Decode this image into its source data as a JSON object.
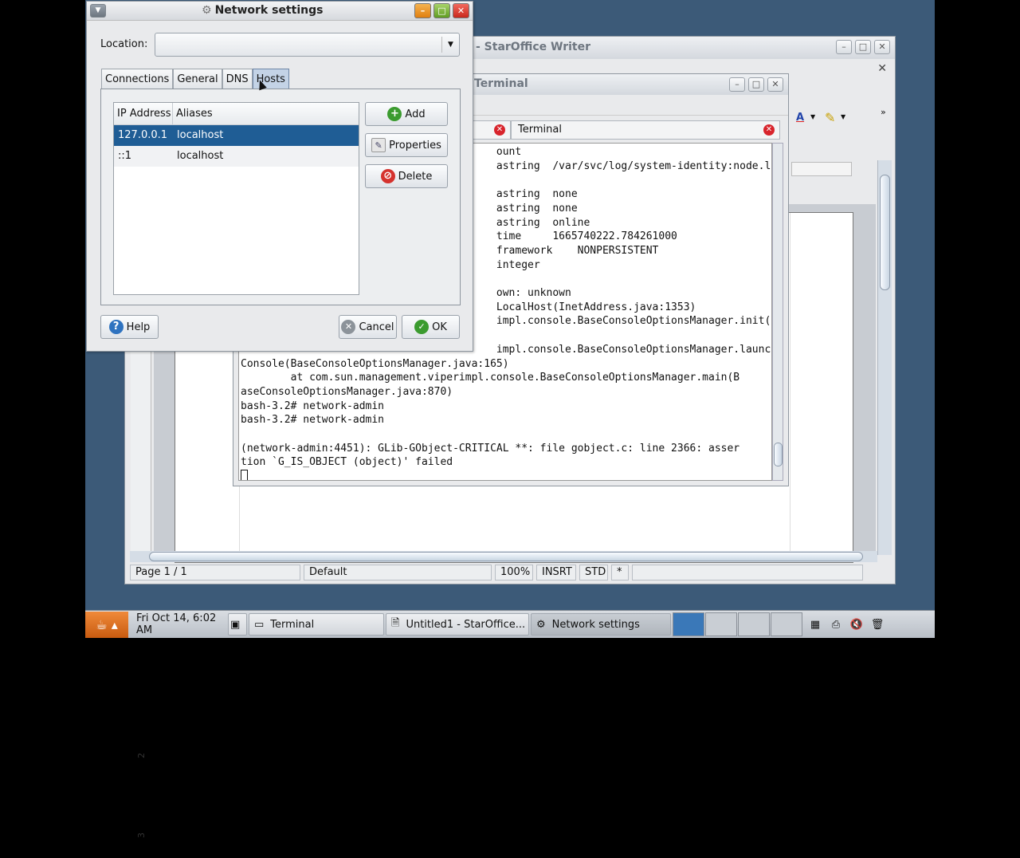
{
  "writer": {
    "title": "- StarOffice Writer",
    "statusbar": {
      "page": "Page 1 / 1",
      "style": "Default",
      "zoom": "100%",
      "insert": "INSRT",
      "mode": "STD",
      "modified": "*"
    }
  },
  "terminal": {
    "title": "Terminal",
    "tabs": [
      "",
      "Terminal"
    ],
    "lines": [
      "ount",
      "astring  /var/svc/log/system-identity:node.lo",
      "",
      "astring  none",
      "astring  none",
      "astring  online",
      "time     1665740222.784261000",
      "framework    NONPERSISTENT",
      "integer",
      "",
      "own: unknown",
      "LocalHost(InetAddress.java:1353)",
      "impl.console.BaseConsoleOptionsManager.init(B",
      "",
      "impl.console.BaseConsoleOptionsManager.launch",
      "Console(BaseConsoleOptionsManager.java:165)",
      "        at com.sun.management.viperimpl.console.BaseConsoleOptionsManager.main(B",
      "aseConsoleOptionsManager.java:870)",
      "bash-3.2# network-admin",
      "bash-3.2# network-admin",
      "",
      "(network-admin:4451): GLib-GObject-CRITICAL **: file gobject.c: line 2366: asser",
      "tion `G_IS_OBJECT (object)' failed"
    ]
  },
  "dialog": {
    "title": "Network settings",
    "location_label": "Location:",
    "location_value": "",
    "tabs": [
      "Connections",
      "General",
      "DNS",
      "Hosts"
    ],
    "active_tab": "Hosts",
    "columns": [
      "IP Address",
      "Aliases"
    ],
    "hosts": [
      {
        "ip": "127.0.0.1",
        "alias": "localhost"
      },
      {
        "ip": "::1",
        "alias": "localhost"
      }
    ],
    "buttons": {
      "add": "Add",
      "properties": "Properties",
      "delete": "Delete",
      "help": "Help",
      "cancel": "Cancel",
      "ok": "OK"
    }
  },
  "taskbar": {
    "clock": "Fri Oct 14,  6:02 AM",
    "items": [
      "Terminal",
      "Untitled1 - StarOffice...",
      "Network settings"
    ],
    "active_item": "Network settings"
  },
  "colors": {
    "desktop": "#3c5a78",
    "selection": "#1f5d95",
    "accent_tab": "#c4d3e6"
  }
}
